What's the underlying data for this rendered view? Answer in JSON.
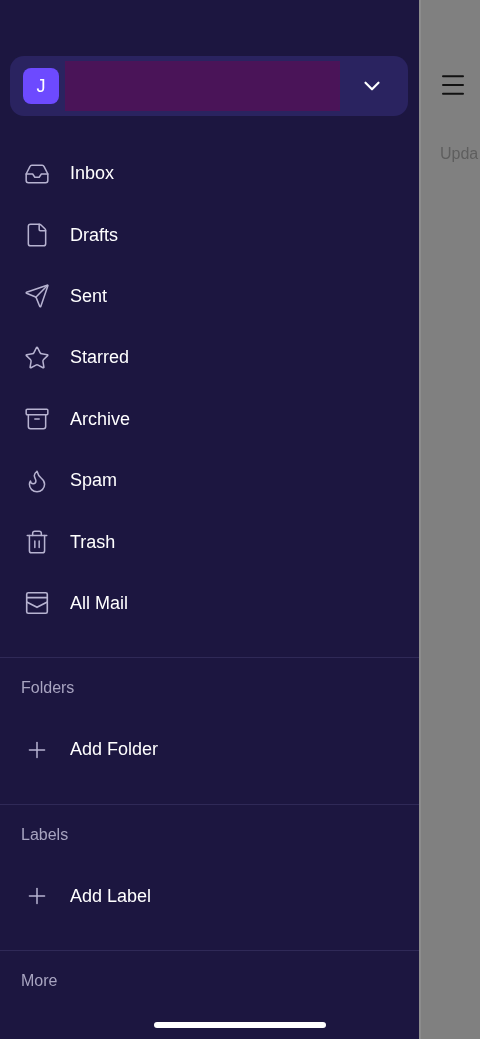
{
  "account": {
    "avatar_initial": "J"
  },
  "mailboxes": [
    {
      "label": "Inbox",
      "kind": "inbox"
    },
    {
      "label": "Drafts",
      "kind": "drafts"
    },
    {
      "label": "Sent",
      "kind": "sent"
    },
    {
      "label": "Starred",
      "kind": "starred"
    },
    {
      "label": "Archive",
      "kind": "archive"
    },
    {
      "label": "Spam",
      "kind": "spam"
    },
    {
      "label": "Trash",
      "kind": "trash"
    },
    {
      "label": "All Mail",
      "kind": "allmail"
    }
  ],
  "sections": [
    {
      "title": "Folders",
      "items": [
        {
          "label": "Add Folder",
          "kind": "add"
        }
      ]
    },
    {
      "title": "Labels",
      "items": [
        {
          "label": "Add Label",
          "kind": "add"
        }
      ]
    },
    {
      "title": "More"
    }
  ],
  "background": {
    "status_text": "Upda"
  }
}
